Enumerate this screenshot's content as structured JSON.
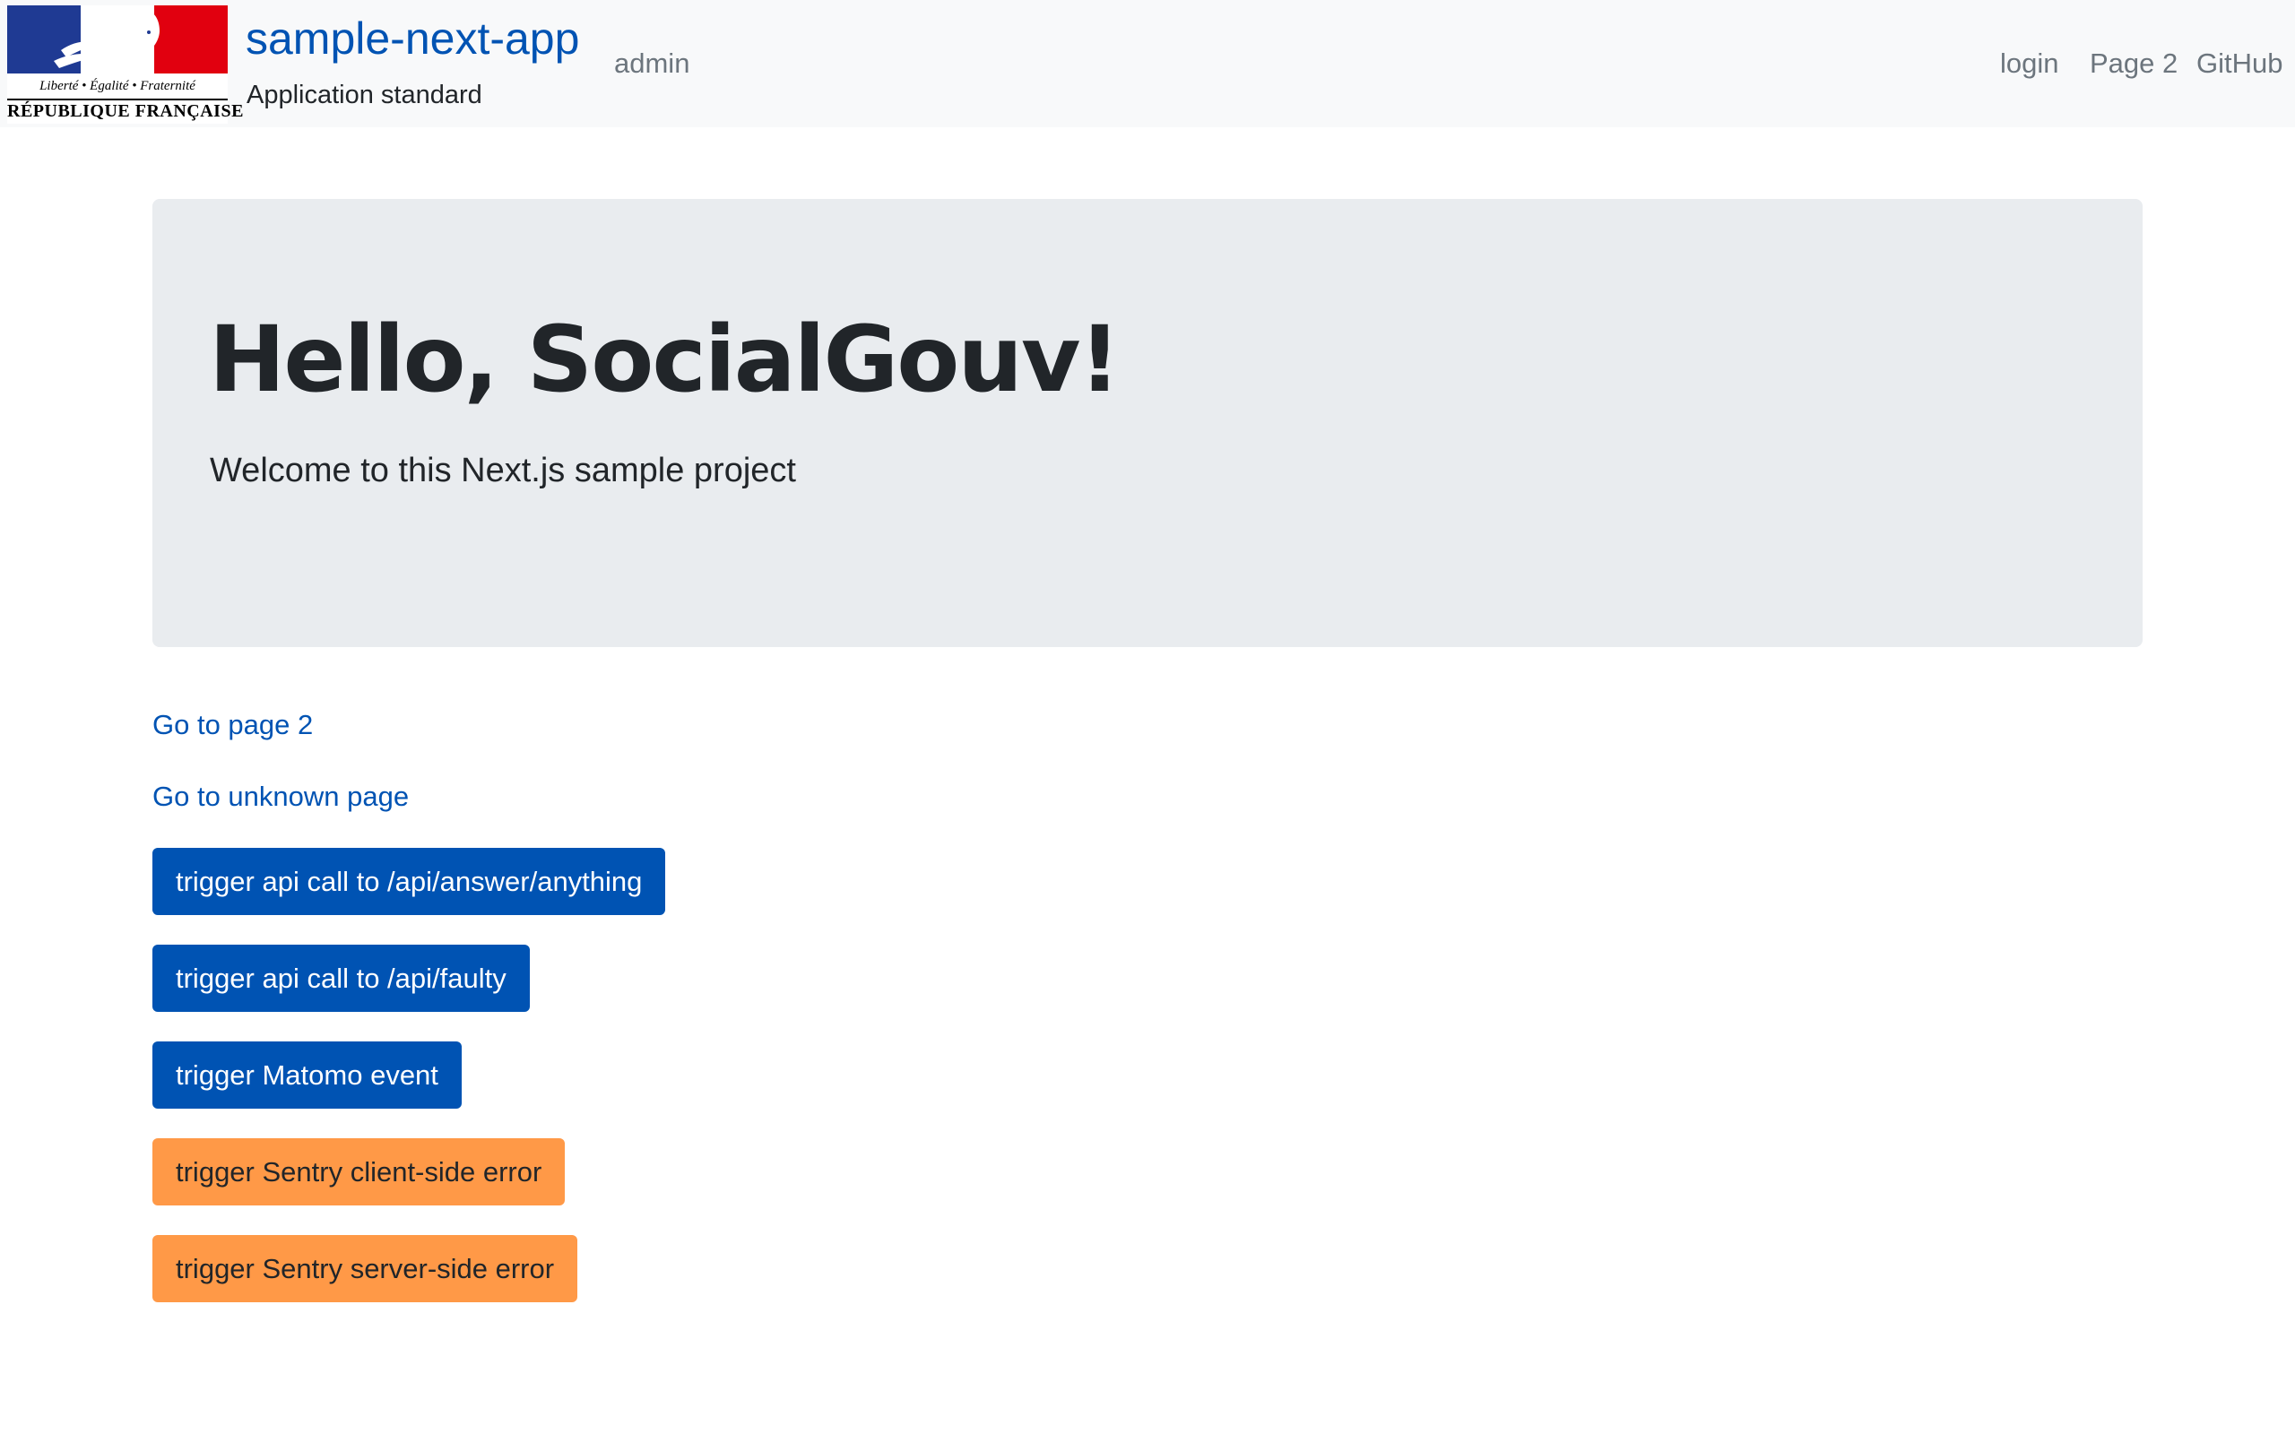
{
  "navbar": {
    "logo": {
      "motto": "Liberté • Égalité • Fraternité",
      "country": "RÉPUBLIQUE FRANÇAISE"
    },
    "brand_title": "sample-next-app",
    "brand_subtitle": "Application standard",
    "links": {
      "admin": "admin",
      "login": "login",
      "page2": "Page 2",
      "github": "GitHub"
    }
  },
  "hero": {
    "title": "Hello, SocialGouv!",
    "lead": "Welcome to this Next.js sample project"
  },
  "links": {
    "page2": "Go to page 2",
    "unknown": "Go to unknown page"
  },
  "buttons": [
    {
      "label": "trigger api call to /api/answer/anything",
      "variant": "primary"
    },
    {
      "label": "trigger api call to /api/faulty",
      "variant": "primary"
    },
    {
      "label": "trigger Matomo event",
      "variant": "primary"
    },
    {
      "label": "trigger Sentry client-side error",
      "variant": "warning"
    },
    {
      "label": "trigger Sentry server-side error",
      "variant": "warning"
    }
  ],
  "colors": {
    "primary": "#0053b3",
    "warning": "#ff9947",
    "navbar_bg": "#f8f9fa",
    "jumbotron_bg": "#e9ecef"
  }
}
